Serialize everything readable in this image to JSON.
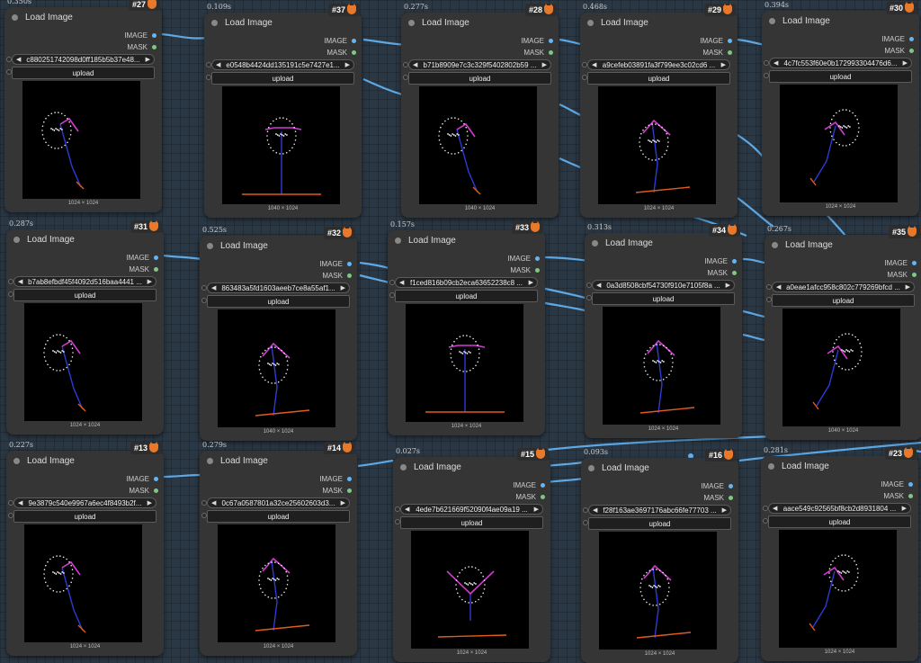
{
  "colors": {
    "canvas": "#2a3744",
    "node_body": "#353535",
    "wire": "#64b5f6",
    "image_port": "#64b5f6",
    "mask_port": "#81c784",
    "pose_magenta": "#d23cd2",
    "pose_blue": "#2e3bd6",
    "pose_orange": "#e25b1e"
  },
  "labels": {
    "node_title": "Load Image",
    "output_image": "IMAGE",
    "output_mask": "MASK",
    "upload_button": "upload",
    "node_icon": "fox-icon"
  },
  "nodes": [
    {
      "id": "#27",
      "time": "0.350s",
      "filename": "c880251742098d0ff185b5b37e48...",
      "dims": "1024 × 1024",
      "pose": "right"
    },
    {
      "id": "#37",
      "time": "0.109s",
      "filename": "e0548b4424dd135191c5e7427e1...",
      "dims": "1040 × 1024",
      "pose": "front"
    },
    {
      "id": "#28",
      "time": "0.277s",
      "filename": "b71b8909e7c3c329f5402802b59 ...",
      "dims": "1040 × 1024",
      "pose": "right"
    },
    {
      "id": "#29",
      "time": "0.468s",
      "filename": "a9cefeb03891fa3f799ee3c02cd6 ...",
      "dims": "1024 × 1024",
      "pose": "left"
    },
    {
      "id": "#30",
      "time": "0.394s",
      "filename": "4c7fc553f60e0b172993304476d6...",
      "dims": "1024 × 1024",
      "pose": "right-low"
    },
    {
      "id": "#31",
      "time": "0.287s",
      "filename": "b7ab8efbdf45f4092d516baa4441 ...",
      "dims": "1024 × 1024",
      "pose": "right"
    },
    {
      "id": "#32",
      "time": "0.525s",
      "filename": "863483a5fd1603aeeb7ce8a55af1...",
      "dims": "1040 × 1024",
      "pose": "left"
    },
    {
      "id": "#33",
      "time": "0.157s",
      "filename": "f1ced816b09cb2eca63652238c8 ...",
      "dims": "1024 × 1024",
      "pose": "front"
    },
    {
      "id": "#34",
      "time": "0.313s",
      "filename": "0a3d8508cbf54730f910e7105f8a ...",
      "dims": "1024 × 1024",
      "pose": "left"
    },
    {
      "id": "#35",
      "time": "0.267s",
      "filename": "a0eae1afcc958c802c779269bfcd ...",
      "dims": "1040 × 1024",
      "pose": "right-low"
    },
    {
      "id": "#13",
      "time": "0.227s",
      "filename": "9e3879c540e9967a6ec4f8493b2f...",
      "dims": "1024 × 1024",
      "pose": "right"
    },
    {
      "id": "#14",
      "time": "0.279s",
      "filename": "0c67a0587801a32ce25602603d3...",
      "dims": "1024 × 1024",
      "pose": "left"
    },
    {
      "id": "#15",
      "time": "0.027s",
      "filename": "4ede7b621669f52090f4ae09a19 ...",
      "dims": "1024 × 1024",
      "pose": "front-v"
    },
    {
      "id": "#16",
      "time": "0.093s",
      "filename": "f28f163ae3697176abc66fe77703 ...",
      "dims": "1024 × 1024",
      "pose": "left"
    },
    {
      "id": "#23",
      "time": "0.281s",
      "filename": "aace549c92565bf8cb2d8931804 ...",
      "dims": "1024 × 1024",
      "pose": "right-low"
    }
  ]
}
